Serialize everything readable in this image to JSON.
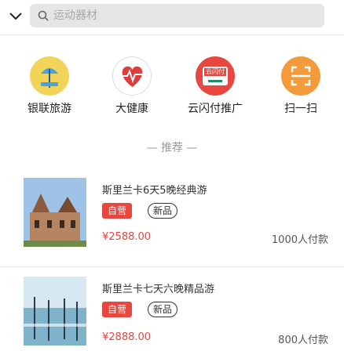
{
  "search": {
    "placeholder": "运动器材"
  },
  "quick_links": [
    {
      "label": "银联旅游",
      "icon": "umbrella-beach-icon",
      "color": "#f3d45a"
    },
    {
      "label": "大健康",
      "icon": "heartbeat-icon",
      "color": "#eeeeee"
    },
    {
      "label": "云闪付推广",
      "icon": "unionpay-card-icon",
      "color": "#e8473f",
      "badge": "云闪付"
    },
    {
      "label": "扫一扫",
      "icon": "scan-icon",
      "color": "#f39a3b"
    }
  ],
  "recommend": {
    "title": "— 推荐 —"
  },
  "products": [
    {
      "title": "斯里兰卡6天5晚经典游",
      "tag_self": "自营",
      "tag_new": "新品",
      "price": "¥2588.00",
      "sold": "1000人付款"
    },
    {
      "title": "斯里兰卡七天六晚精品游",
      "tag_self": "自营",
      "tag_new": "新品",
      "price": "¥2888.00",
      "sold": "800人付款"
    }
  ],
  "colors": {
    "accent": "#e8473f",
    "search_bg": "#e5e5e5"
  }
}
